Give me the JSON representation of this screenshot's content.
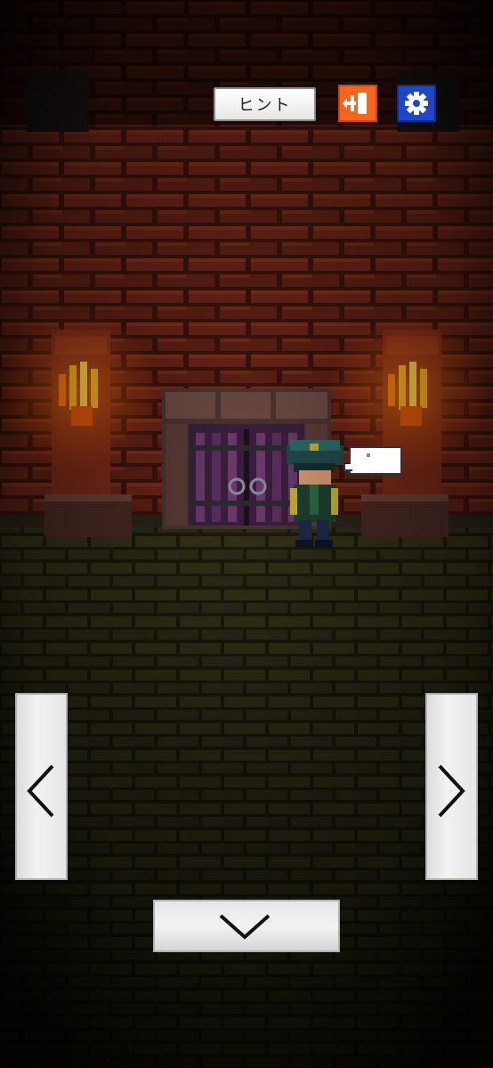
{
  "toolbar": {
    "hint_label": "ヒント",
    "exit_icon": "exit-door-icon",
    "settings_icon": "gear-icon",
    "exit_color": "#f5651d",
    "settings_color": "#1d46c8"
  },
  "navigation": {
    "left_icon": "chevron-left-icon",
    "right_icon": "chevron-right-icon",
    "down_icon": "chevron-down-icon"
  },
  "scene": {
    "wall_color": "#5a1e12",
    "floor_color": "#2c2a14",
    "flame_color": "#ffb21c"
  }
}
